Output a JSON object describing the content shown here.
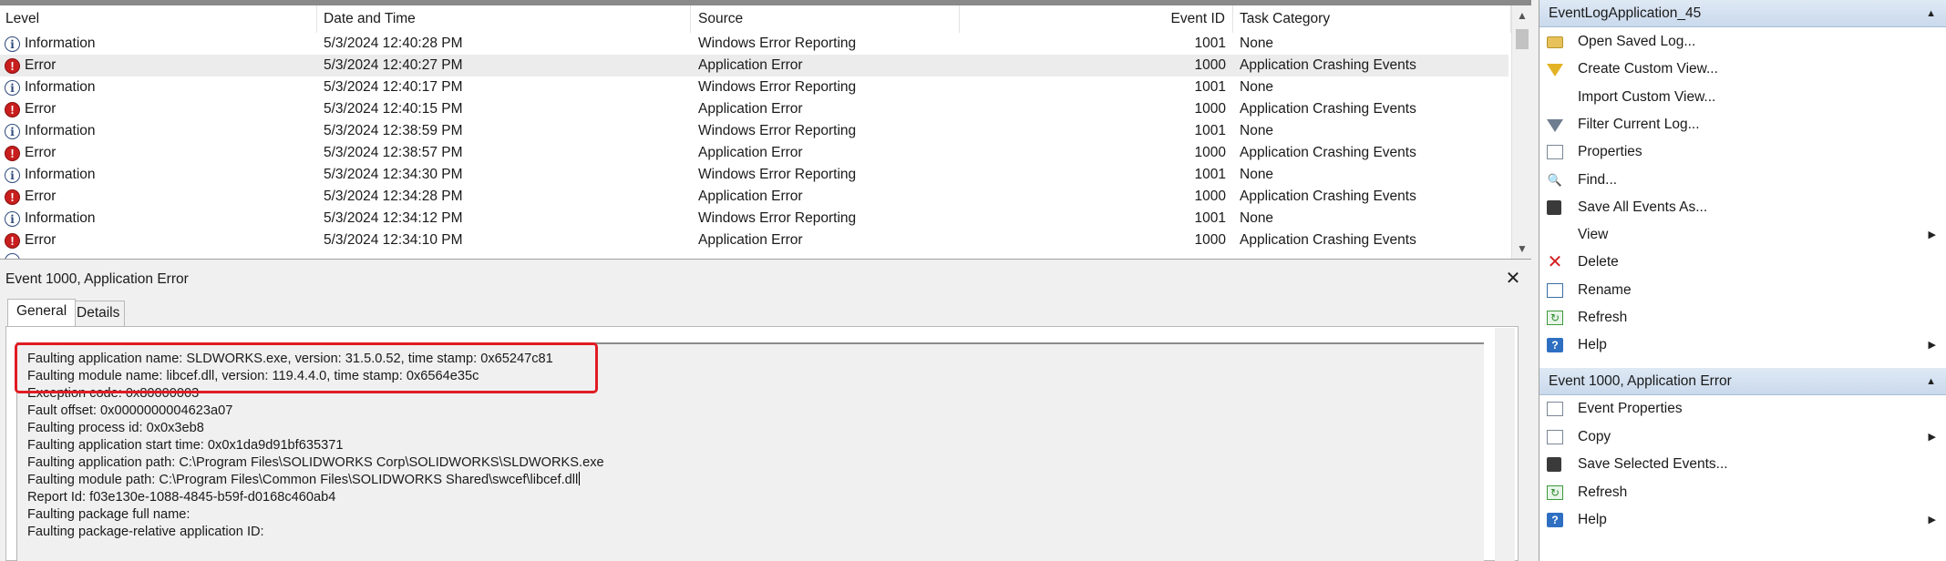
{
  "event_list": {
    "columns": {
      "level": "Level",
      "datetime": "Date and Time",
      "source": "Source",
      "event_id": "Event ID",
      "task_category": "Task Category"
    },
    "rows": [
      {
        "level": "Information",
        "kind": "info",
        "datetime": "5/3/2024 12:40:28 PM",
        "source": "Windows Error Reporting",
        "event_id": "1001",
        "task": "None"
      },
      {
        "level": "Error",
        "kind": "error",
        "datetime": "5/3/2024 12:40:27 PM",
        "source": "Application Error",
        "event_id": "1000",
        "task": "Application Crashing Events"
      },
      {
        "level": "Information",
        "kind": "info",
        "datetime": "5/3/2024 12:40:17 PM",
        "source": "Windows Error Reporting",
        "event_id": "1001",
        "task": "None"
      },
      {
        "level": "Error",
        "kind": "error",
        "datetime": "5/3/2024 12:40:15 PM",
        "source": "Application Error",
        "event_id": "1000",
        "task": "Application Crashing Events"
      },
      {
        "level": "Information",
        "kind": "info",
        "datetime": "5/3/2024 12:38:59 PM",
        "source": "Windows Error Reporting",
        "event_id": "1001",
        "task": "None"
      },
      {
        "level": "Error",
        "kind": "error",
        "datetime": "5/3/2024 12:38:57 PM",
        "source": "Application Error",
        "event_id": "1000",
        "task": "Application Crashing Events"
      },
      {
        "level": "Information",
        "kind": "info",
        "datetime": "5/3/2024 12:34:30 PM",
        "source": "Windows Error Reporting",
        "event_id": "1001",
        "task": "None"
      },
      {
        "level": "Error",
        "kind": "error",
        "datetime": "5/3/2024 12:34:28 PM",
        "source": "Application Error",
        "event_id": "1000",
        "task": "Application Crashing Events"
      },
      {
        "level": "Information",
        "kind": "info",
        "datetime": "5/3/2024 12:34:12 PM",
        "source": "Windows Error Reporting",
        "event_id": "1001",
        "task": "None"
      },
      {
        "level": "Error",
        "kind": "error",
        "datetime": "5/3/2024 12:34:10 PM",
        "source": "Application Error",
        "event_id": "1000",
        "task": "Application Crashing Events"
      }
    ],
    "selected_row": 1
  },
  "detail": {
    "title": "Event 1000, Application Error",
    "close_glyph": "✕",
    "tabs": [
      "General",
      "Details"
    ],
    "active_tab": "General",
    "description": [
      "Faulting application name: SLDWORKS.exe, version: 31.5.0.52, time stamp: 0x65247c81",
      "Faulting module name: libcef.dll, version: 119.4.4.0, time stamp: 0x6564e35c",
      "Exception code: 0x80000003",
      "Fault offset: 0x0000000004623a07",
      "Faulting process id: 0x0x3eb8",
      "Faulting application start time: 0x0x1da9d91bf635371",
      "Faulting application path: C:\\Program Files\\SOLIDWORKS Corp\\SOLIDWORKS\\SLDWORKS.exe",
      "Faulting module path: C:\\Program Files\\Common Files\\SOLIDWORKS Shared\\swcef\\libcef.dll",
      "Report Id: f03e130e-1088-4845-b59f-d0168c460ab4",
      "Faulting package full name:",
      "Faulting package-relative application ID:"
    ],
    "highlight_color": "#e01c24"
  },
  "actions": {
    "section1": {
      "title": "EventLogApplication_45",
      "items": [
        {
          "label": "Open Saved Log...",
          "icon": "folder-icon",
          "submenu": false
        },
        {
          "label": "Create Custom View...",
          "icon": "filter-icon",
          "submenu": false
        },
        {
          "label": "Import Custom View...",
          "icon": "",
          "submenu": false
        },
        {
          "label": "Filter Current Log...",
          "icon": "filter-icon",
          "submenu": false
        },
        {
          "label": "Properties",
          "icon": "properties-icon",
          "submenu": false
        },
        {
          "label": "Find...",
          "icon": "find-icon",
          "submenu": false
        },
        {
          "label": "Save All Events As...",
          "icon": "save-icon",
          "submenu": false
        },
        {
          "label": "View",
          "icon": "",
          "submenu": true
        },
        {
          "label": "Delete",
          "icon": "delete-icon",
          "submenu": false
        },
        {
          "label": "Rename",
          "icon": "rename-icon",
          "submenu": false
        },
        {
          "label": "Refresh",
          "icon": "refresh-icon",
          "submenu": false
        },
        {
          "label": "Help",
          "icon": "help-icon",
          "submenu": true
        }
      ]
    },
    "section2": {
      "title": "Event 1000, Application Error",
      "items": [
        {
          "label": "Event Properties",
          "icon": "properties-icon",
          "submenu": false
        },
        {
          "label": "Copy",
          "icon": "copy-icon",
          "submenu": true
        },
        {
          "label": "Save Selected Events...",
          "icon": "save-icon",
          "submenu": false
        },
        {
          "label": "Refresh",
          "icon": "refresh-icon",
          "submenu": false
        },
        {
          "label": "Help",
          "icon": "help-icon",
          "submenu": true
        }
      ]
    }
  }
}
